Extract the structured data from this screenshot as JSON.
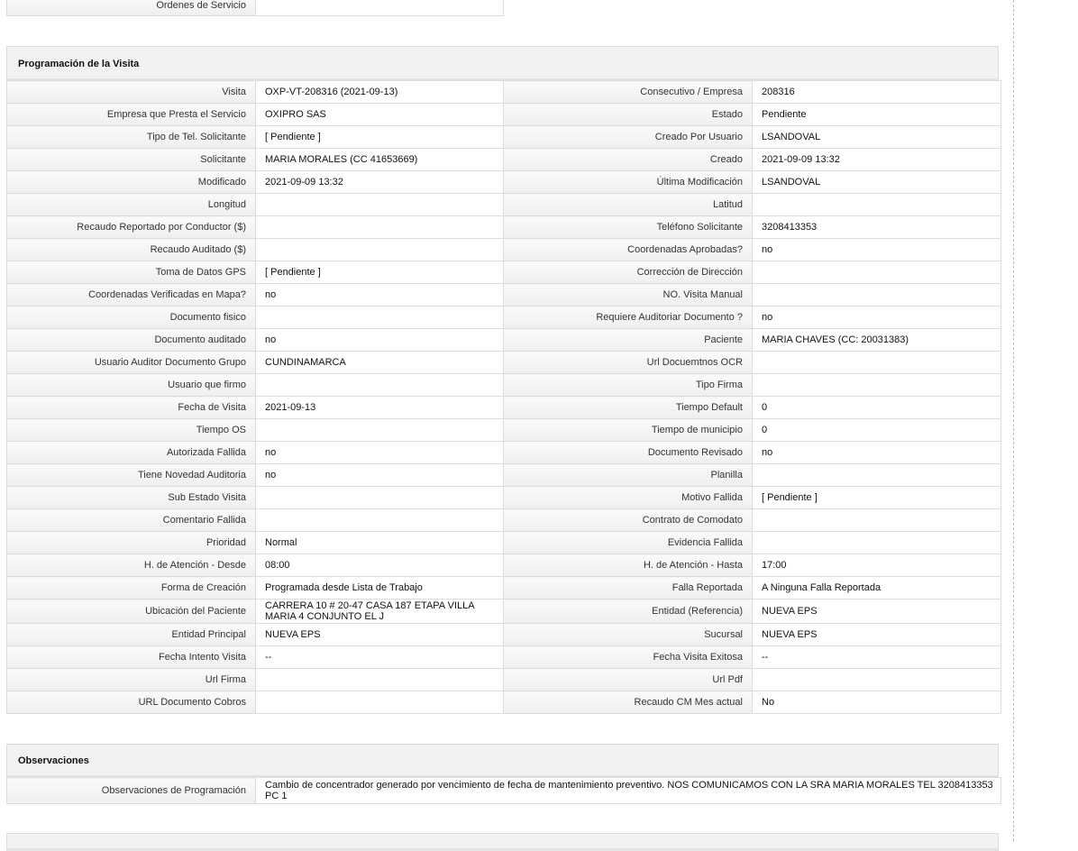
{
  "top": {
    "label": "Ordenes de Servicio",
    "value": ""
  },
  "programacion": {
    "title": "Programación de la Visita",
    "rows": [
      {
        "l1": "Visita",
        "v1": "OXP-VT-208316 (2021-09-13)",
        "l2": "Consecutivo / Empresa",
        "v2": "208316"
      },
      {
        "l1": "Empresa que Presta el Servicio",
        "v1": "OXIPRO SAS",
        "l2": "Estado",
        "v2": "Pendiente"
      },
      {
        "l1": "Tipo de Tel. Solicitante",
        "v1": "[ Pendiente ]",
        "l2": "Creado Por Usuario",
        "v2": "LSANDOVAL"
      },
      {
        "l1": "Solicitante",
        "v1": "MARIA MORALES (CC 41653669)",
        "l2": "Creado",
        "v2": "2021-09-09 13:32"
      },
      {
        "l1": "Modificado",
        "v1": "2021-09-09 13:32",
        "l2": "Última Modificación",
        "v2": " LSANDOVAL"
      },
      {
        "l1": "Longitud",
        "v1": "",
        "l2": "Latitud",
        "v2": ""
      },
      {
        "l1": "Recaudo Reportado por Conductor ($)",
        "v1": "",
        "l2": "Teléfono Solicitante",
        "v2": "3208413353"
      },
      {
        "l1": "Recaudo Auditado ($)",
        "v1": "",
        "l2": "Coordenadas Aprobadas?",
        "v2": " no"
      },
      {
        "l1": "Toma de Datos GPS",
        "v1": "[ Pendiente ]",
        "l2": "Corrección de Dirección",
        "v2": ""
      },
      {
        "l1": "Coordenadas Verificadas en Mapa?",
        "v1": " no",
        "l2": "NO. Visita Manual",
        "v2": ""
      },
      {
        "l1": "Documento fisico",
        "v1": "",
        "l2": "Requiere Auditoriar Documento ?",
        "v2": " no"
      },
      {
        "l1": "Documento auditado",
        "v1": " no",
        "l2": "Paciente",
        "v2": "MARIA CHAVES (CC: 20031383)"
      },
      {
        "l1": "Usuario Auditor Documento Grupo",
        "v1": "CUNDINAMARCA",
        "l2": "Url Docuemtnos OCR",
        "v2": ""
      },
      {
        "l1": "Usuario que firmo",
        "v1": "",
        "l2": "Tipo Firma",
        "v2": ""
      },
      {
        "l1": "Fecha de Visita",
        "v1": " 2021-09-13",
        "l2": "Tiempo Default",
        "v2": "0"
      },
      {
        "l1": "Tiempo OS",
        "v1": "",
        "l2": "Tiempo de municipio",
        "v2": "0"
      },
      {
        "l1": "Autorizada Fallida",
        "v1": " no",
        "l2": "Documento Revisado",
        "v2": " no"
      },
      {
        "l1": "Tiene Novedad Auditoria",
        "v1": " no",
        "l2": "Planilla",
        "v2": ""
      },
      {
        "l1": "Sub Estado Visita",
        "v1": "",
        "l2": "Motivo Fallida",
        "v2": "[ Pendiente ]"
      },
      {
        "l1": "Comentario Fallida",
        "v1": "",
        "l2": "Contrato de Comodato",
        "v2": ""
      },
      {
        "l1": "Prioridad",
        "v1": "Normal",
        "l2": "Evidencia Fallida",
        "v2": ""
      },
      {
        "l1": "H. de Atención - Desde",
        "v1": "08:00",
        "l2": "H. de Atención - Hasta",
        "v2": "17:00"
      },
      {
        "l1": "Forma de Creación",
        "v1": "Programada desde Lista de Trabajo",
        "l2": "Falla Reportada",
        "v2": "A Ninguna Falla Reportada"
      },
      {
        "l1": "Ubicación del Paciente",
        "v1": "CARRERA 10 # 20-47 CASA 187 ETAPA VILLA MARIA 4 CONJUNTO EL J",
        "l2": "Entidad (Referencia)",
        "v2": "NUEVA EPS",
        "wrap": true
      },
      {
        "l1": "Entidad Principal",
        "v1": "NUEVA EPS",
        "l2": "Sucursal",
        "v2": "NUEVA EPS"
      },
      {
        "l1": "Fecha Intento Visita",
        "v1": " --",
        "l2": "Fecha Visita Exitosa",
        "v2": " --"
      },
      {
        "l1": "Url Firma",
        "v1": "",
        "l2": "Url Pdf",
        "v2": ""
      },
      {
        "l1": "URL Documento Cobros",
        "v1": "",
        "l2": "Recaudo CM Mes actual",
        "v2": "No"
      }
    ]
  },
  "observaciones": {
    "title": "Observaciones",
    "label": "Observaciones de Programación",
    "value": "  Cambio de concentrador generado por vencimiento de fecha de mantenimiento preventivo. NOS COMUNICAMOS CON LA SRA MARIA MORALES TEL 3208413353 PC 1"
  }
}
